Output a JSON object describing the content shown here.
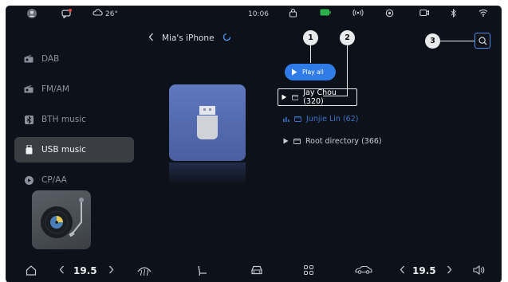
{
  "status_bar": {
    "weather_temp": "26°",
    "time": "10:06",
    "icons": [
      "avatar-icon",
      "message-icon",
      "cloud-icon",
      "bag-icon",
      "battery-icon",
      "hotspot-icon",
      "location-icon",
      "camera-icon",
      "bluetooth-icon",
      "wifi-icon"
    ]
  },
  "sidebar": {
    "items": [
      {
        "label": "DAB",
        "icon": "radio-icon",
        "active": false
      },
      {
        "label": "FM/AM",
        "icon": "radio-icon",
        "active": false
      },
      {
        "label": "BTH music",
        "icon": "bluetooth-icon",
        "active": false
      },
      {
        "label": "USB music",
        "icon": "usb-icon",
        "active": true
      },
      {
        "label": "CP/AA",
        "icon": "carplay-icon",
        "active": false
      }
    ]
  },
  "header": {
    "device_name": "Mia's iPhone",
    "back_icon": "chevron-left-icon"
  },
  "play_all": {
    "label": "Play all"
  },
  "list": {
    "items": [
      {
        "label": "Jay Chou (320)",
        "state": "selected"
      },
      {
        "label": "Junjie Lin (62)",
        "state": "playing"
      },
      {
        "label": "Root directory (366)",
        "state": "normal"
      }
    ]
  },
  "callouts": [
    "1",
    "2",
    "3"
  ],
  "bottom_bar": {
    "left_temp": "19.5",
    "right_temp": "19.5",
    "icons": [
      "home-icon",
      "chevron-left-icon",
      "chevron-right-icon",
      "defrost-icon",
      "seat-icon",
      "car-front-icon",
      "apps-grid-icon",
      "car-side-icon",
      "volume-icon"
    ]
  },
  "colors": {
    "accent": "#2f7be7",
    "background": "#0d121a",
    "active_item": "#3a3d42",
    "usb_tile": "#5a72b8"
  }
}
